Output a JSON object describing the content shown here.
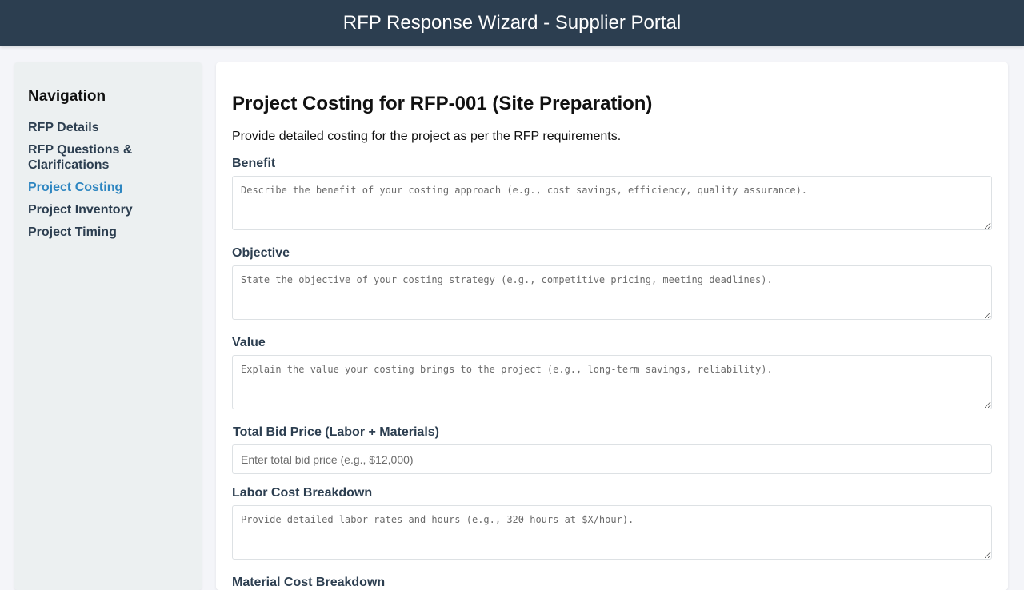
{
  "header": {
    "title": "RFP Response Wizard - Supplier Portal"
  },
  "sidebar": {
    "title": "Navigation",
    "items": [
      {
        "label": "RFP Details",
        "active": false
      },
      {
        "label": "RFP Questions & Clarifications",
        "active": false
      },
      {
        "label": "Project Costing",
        "active": true
      },
      {
        "label": "Project Inventory",
        "active": false
      },
      {
        "label": "Project Timing",
        "active": false
      }
    ]
  },
  "main": {
    "title": "Project Costing for RFP-001 (Site Preparation)",
    "intro": "Provide detailed costing for the project as per the RFP requirements.",
    "benefit": {
      "label": "Benefit",
      "placeholder": "Describe the benefit of your costing approach (e.g., cost savings, efficiency, quality assurance).",
      "value": ""
    },
    "objective": {
      "label": "Objective",
      "placeholder": "State the objective of your costing strategy (e.g., competitive pricing, meeting deadlines).",
      "value": ""
    },
    "value_field": {
      "label": "Value",
      "placeholder": "Explain the value your costing brings to the project (e.g., long-term savings, reliability).",
      "value": ""
    },
    "total_bid": {
      "label": "Total Bid Price (Labor + Materials)",
      "placeholder": "Enter total bid price (e.g., $12,000)",
      "value": ""
    },
    "labor": {
      "label": "Labor Cost Breakdown",
      "placeholder": "Provide detailed labor rates and hours (e.g., 320 hours at $X/hour).",
      "value": ""
    },
    "material": {
      "label": "Material Cost Breakdown"
    }
  },
  "colors": {
    "header_bg": "#2c3e50",
    "sidebar_bg": "#ecf0f1",
    "active_link": "#2e86c1",
    "label_text": "#2c3e50"
  }
}
